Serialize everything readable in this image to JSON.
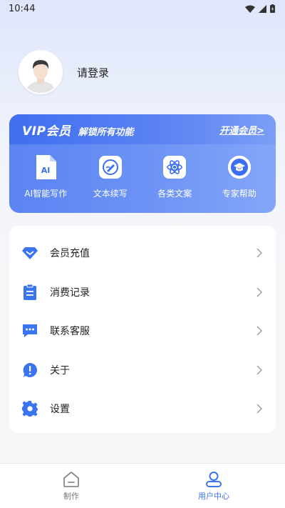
{
  "status_bar": {
    "time": "10:44"
  },
  "profile": {
    "login_text": "请登录"
  },
  "vip": {
    "title": "VIP会员",
    "subtitle": "解锁所有功能",
    "open_label": "开通会员>",
    "features": [
      {
        "label": "AI智能写作",
        "icon": "ai-doc-icon",
        "icon_text": "AI"
      },
      {
        "label": "文本续写",
        "icon": "pen-edit-icon"
      },
      {
        "label": "各类文案",
        "icon": "atom-icon"
      },
      {
        "label": "专家帮助",
        "icon": "graduation-cap-icon"
      }
    ]
  },
  "menu": {
    "items": [
      {
        "label": "会员充值",
        "icon": "diamond-icon"
      },
      {
        "label": "消费记录",
        "icon": "clipboard-icon"
      },
      {
        "label": "联系客服",
        "icon": "chat-icon"
      },
      {
        "label": "关于",
        "icon": "info-alert-icon"
      },
      {
        "label": "设置",
        "icon": "gear-icon"
      }
    ]
  },
  "tabs": [
    {
      "label": "制作",
      "icon": "home-icon",
      "active": false
    },
    {
      "label": "用户中心",
      "icon": "user-icon",
      "active": true
    }
  ],
  "colors": {
    "accent": "#3b74f0",
    "vip_gradient_start": "#3f6ef0",
    "vip_gradient_end": "#84a6f8"
  }
}
